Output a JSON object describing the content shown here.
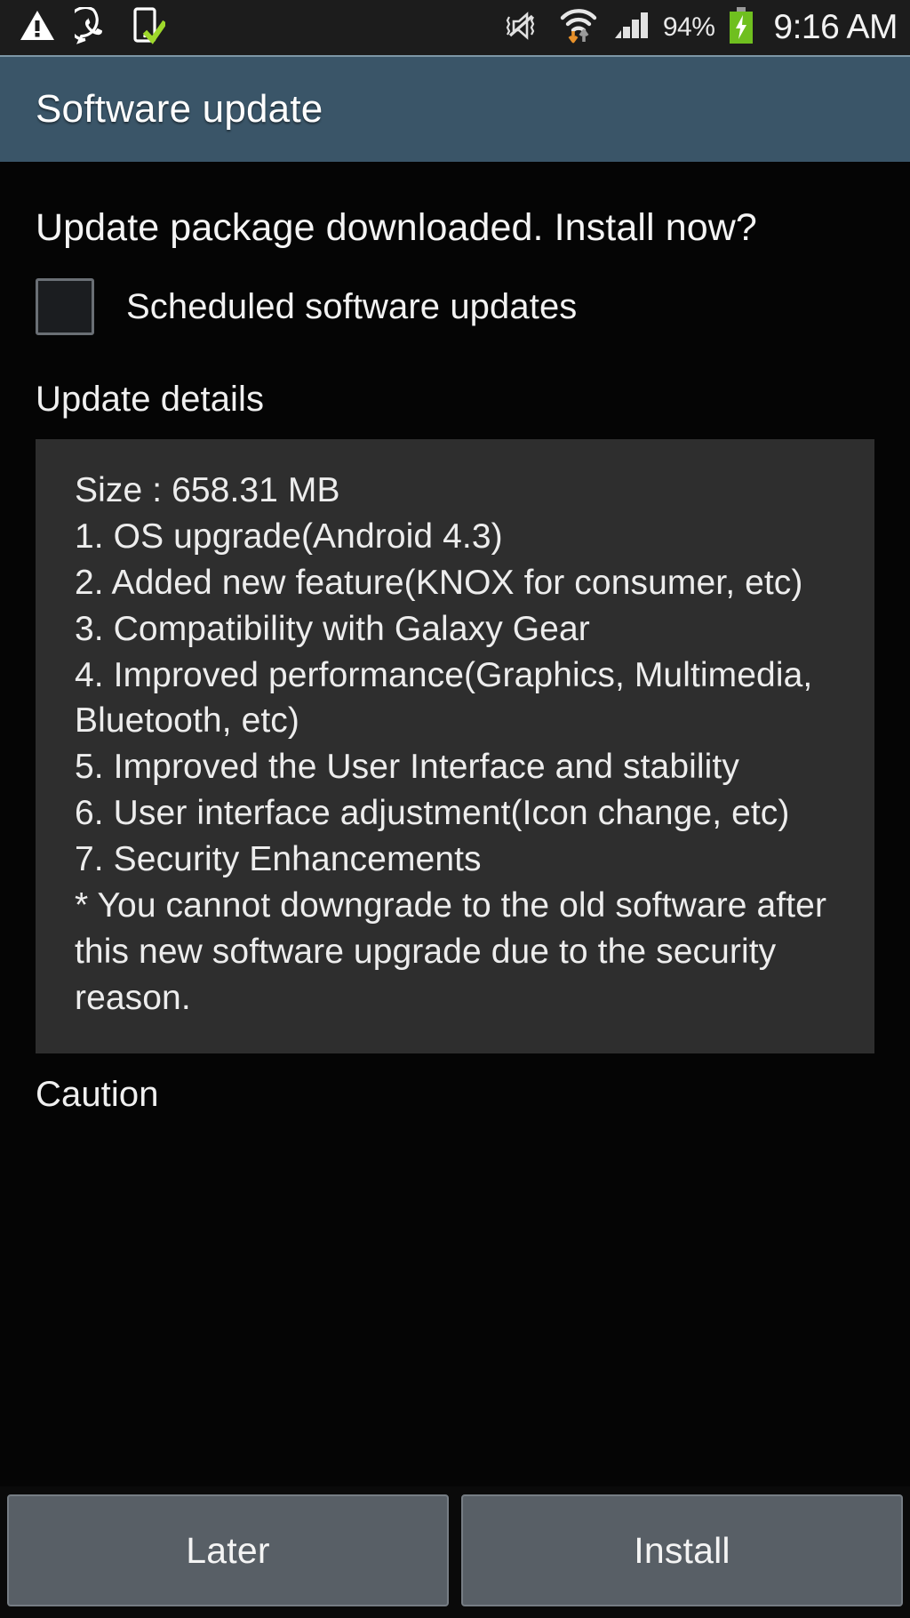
{
  "status_bar": {
    "icons_left": [
      "warning-triangle-icon",
      "whatsapp-icon",
      "phone-check-icon"
    ],
    "icons_right": [
      "mute-vibrate-icon",
      "wifi-data-transfer-icon",
      "signal-bars-icon"
    ],
    "battery_percent": "94%",
    "battery_state": "charging",
    "time": "9:16 AM"
  },
  "header": {
    "title": "Software update",
    "accent_color": "#3a5568"
  },
  "main": {
    "prompt": "Update package downloaded. Install now?",
    "checkbox": {
      "label": "Scheduled software updates",
      "checked": false
    },
    "details_heading": "Update details",
    "details_text": "Size : 658.31 MB\n1. OS upgrade(Android 4.3)\n2. Added new feature(KNOX for consumer, etc)\n3. Compatibility with Galaxy Gear\n4. Improved performance(Graphics, Multimedia, Bluetooth, etc)\n5. Improved the User Interface and stability\n6. User interface adjustment(Icon change, etc)\n7. Security Enhancements\n* You cannot downgrade to the old software after this new software upgrade due to the security reason.",
    "size_value": "658.31 MB",
    "caution_heading": "Caution"
  },
  "buttons": {
    "later_label": "Later",
    "install_label": "Install"
  }
}
